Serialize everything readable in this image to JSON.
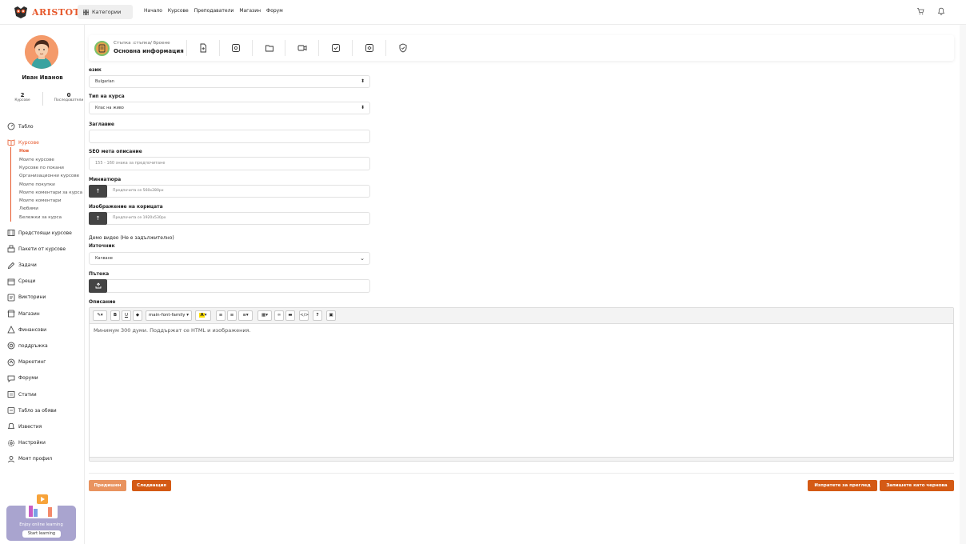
{
  "brand": {
    "name": "ARISTOTLE",
    "accent": "#e6572a"
  },
  "topnav": {
    "categories": "Категории",
    "links": [
      "Начало",
      "Курсове",
      "Преподаватели",
      "Магазин",
      "Форум"
    ],
    "cart_icon": "cart-icon",
    "bell_icon": "bell-icon"
  },
  "user": {
    "name": "Иван Иванов",
    "courses_count": "2",
    "courses_label": "Курсове",
    "followers_count": "0",
    "followers_label": "Последователи"
  },
  "sidebar": {
    "items": [
      {
        "label": "Табло",
        "icon": "gauge-icon"
      },
      {
        "label": "Курсове",
        "icon": "book-icon"
      },
      {
        "label": "Предстоящи курсове",
        "icon": "film-icon"
      },
      {
        "label": "Пакети от курсове",
        "icon": "bundle-icon"
      },
      {
        "label": "Задачи",
        "icon": "pen-icon"
      },
      {
        "label": "Срещи",
        "icon": "calendar-icon"
      },
      {
        "label": "Викторини",
        "icon": "quiz-icon"
      },
      {
        "label": "Магазин",
        "icon": "store-icon"
      },
      {
        "label": "Финансови",
        "icon": "finance-icon"
      },
      {
        "label": "поддръжка",
        "icon": "support-icon"
      },
      {
        "label": "Маркетинг",
        "icon": "marketing-icon"
      },
      {
        "label": "Форуми",
        "icon": "forum-icon"
      },
      {
        "label": "Статии",
        "icon": "article-icon"
      },
      {
        "label": "Табло за обяви",
        "icon": "board-icon"
      },
      {
        "label": "Известия",
        "icon": "notification-icon"
      },
      {
        "label": "Настройки",
        "icon": "settings-icon"
      },
      {
        "label": "Моят профил",
        "icon": "user-icon"
      }
    ],
    "course_sub": [
      "Нов",
      "Моите курсове",
      "Курсове по покани",
      "Организационни курсове",
      "Моите покупки",
      "Моите коментари за курса",
      "Моите коментари",
      "Любими",
      "Бележки за курса"
    ]
  },
  "promo": {
    "text": "Enjoy online learning",
    "button": "Start learning"
  },
  "steps": {
    "crumb": "Стъпка :стъпка/ броене",
    "title": "Основна информация",
    "icons": [
      "file-plus-icon",
      "media-icon",
      "folder-icon",
      "video-icon",
      "checkbox-icon",
      "quiz-icon",
      "shield-check-icon"
    ]
  },
  "form": {
    "language_label": "език",
    "language_value": "Bulgarian",
    "type_label": "Тип на курса",
    "type_value": "Клас на живо",
    "title_label": "Заглавие",
    "title_value": "",
    "seo_label": "SEO мета описание",
    "seo_placeholder": "155 - 160 знака за предпочитане",
    "thumb_label": "Миниатюра",
    "thumb_placeholder": "Предпочита се 560x280px",
    "cover_label": "Изображение на корицата",
    "cover_placeholder": "Предпочита се 1920x530px",
    "demo_label": "Демо видео (Не е задължително)",
    "source_label": "Източник",
    "source_value": "Качване",
    "path_label": "Пътека",
    "desc_label": "Описание",
    "desc_placeholder": "Минимум 300 думи. Поддържат се HTML и изображения.",
    "font_family": "main-font-family"
  },
  "buttons": {
    "prev": "Предишен",
    "next": "Следващия",
    "review": "Изпратете за преглед",
    "draft": "Запишете като чернова"
  }
}
